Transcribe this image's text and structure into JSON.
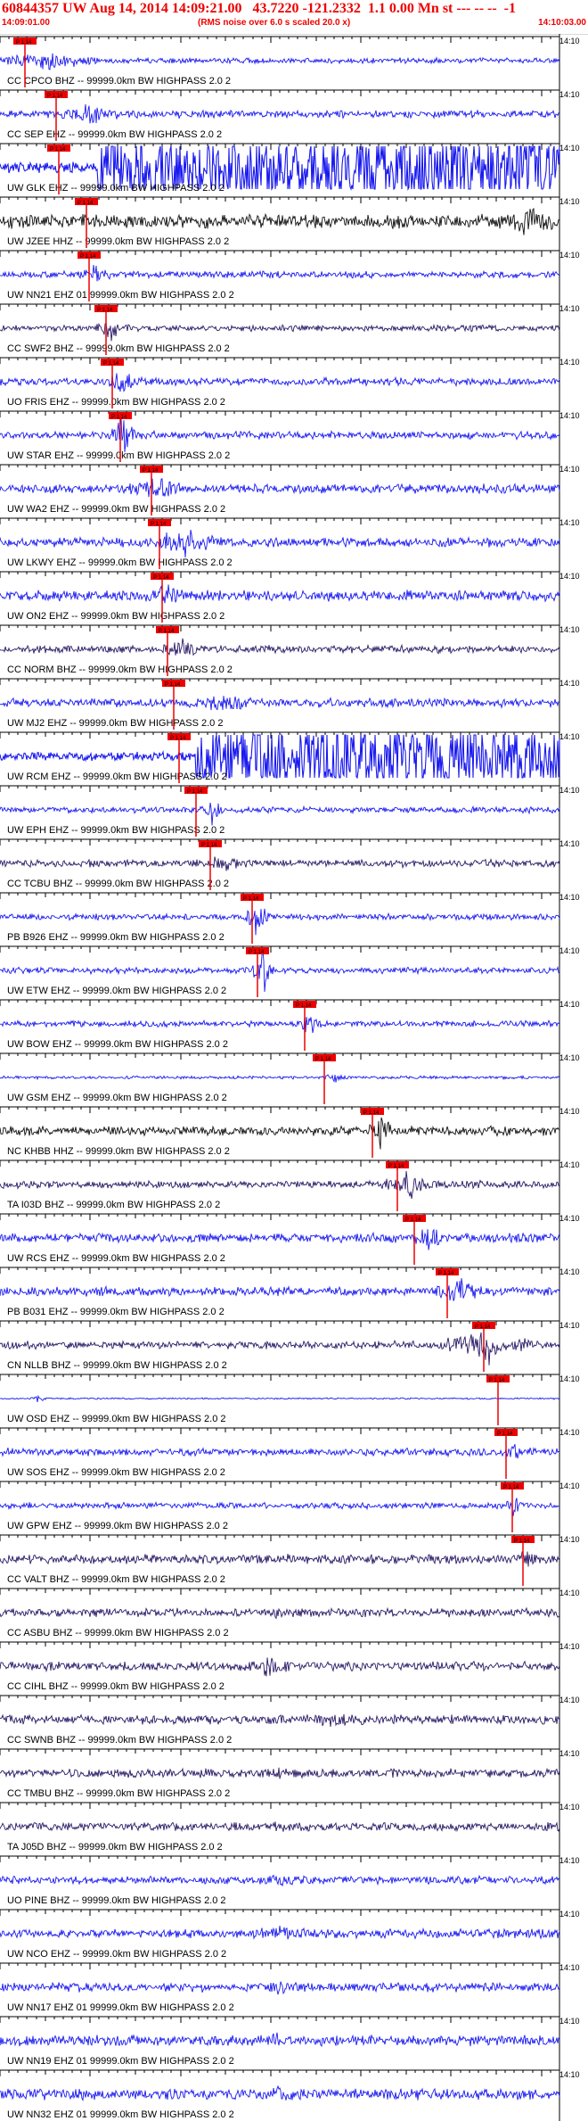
{
  "header": {
    "title": "60844357 UW Aug 14, 2014 14:09:21.00   43.7220 -121.2332  1.1 0.00 Mn st --- -- --  -1",
    "left_time": "14:09:01.00",
    "note": "(RMS noise over 6.0 s scaled 20.0 x)",
    "right_time": "14:10:03.00"
  },
  "colors": {
    "title": "#ee0000",
    "trace_blue": "#1a1af0",
    "trace_purple": "#2a1a66",
    "trace_black": "#111111",
    "pick_marker": "#ee0000",
    "pick_label_bg": "#ee0000",
    "pick_label_text": "#000000",
    "timeline": "#000000"
  },
  "time_axis_label": "14:10",
  "channels": [
    {
      "label": "CC CPCO BHZ -- 99999.0km BW  HIGHPASS  2.0  2",
      "color": "trace_blue",
      "amp": 0.18,
      "burst": 0.09,
      "burst_width": 0.18,
      "burst_amp": 0.6,
      "pick": 0.045,
      "pick_label": "P 1.14"
    },
    {
      "label": "CC SEP EHZ -- 99999.0km BW  HIGHPASS  2.0  2",
      "color": "trace_blue",
      "amp": 0.25,
      "burst": 0.16,
      "burst_width": 0.1,
      "burst_amp": 0.7,
      "pick": 0.1,
      "pick_label": "P 1.14"
    },
    {
      "label": "UW GLK EHZ -- 99999.0km BW  HIGHPASS  2.0  2",
      "color": "trace_blue",
      "amp": 0.35,
      "burst": 0.6,
      "burst_width": 0.85,
      "burst_amp": 2.4,
      "pick": 0.105,
      "pick_label": "P 1.14",
      "saturated": true
    },
    {
      "label": "UW JZEE HHZ -- 99999.0km BW  HIGHPASS  2.0  2",
      "color": "trace_black",
      "amp": 0.45,
      "burst": 0.95,
      "burst_width": 0.08,
      "burst_amp": 0.9,
      "pick": 0.155,
      "pick_label": "P 1.14"
    },
    {
      "label": "UW NN21 EHZ 01 99999.0km BW  HIGHPASS  2.0  2",
      "color": "trace_blue",
      "amp": 0.22,
      "burst": 0.17,
      "burst_width": 0.06,
      "burst_amp": 0.6,
      "pick": 0.16,
      "pick_label": "P 1.14"
    },
    {
      "label": "CC SWF2 BHZ -- 99999.0km BW  HIGHPASS  2.0  2",
      "color": "trace_purple",
      "amp": 0.2,
      "burst": 0.2,
      "burst_width": 0.06,
      "burst_amp": 0.8,
      "pick": 0.19,
      "pick_label": "P 1.14"
    },
    {
      "label": "UO FRIS EHZ -- 99999.0km BW  HIGHPASS  2.0  2",
      "color": "trace_blue",
      "amp": 0.25,
      "burst": 0.22,
      "burst_width": 0.07,
      "burst_amp": 0.9,
      "pick": 0.2,
      "pick_label": "P 1.14"
    },
    {
      "label": "UW STAR EHZ -- 99999.0km BW  HIGHPASS  2.0  2",
      "color": "trace_blue",
      "amp": 0.25,
      "burst": 0.22,
      "burst_width": 0.05,
      "burst_amp": 1.3,
      "pick": 0.215,
      "pick_label": "P 1.14"
    },
    {
      "label": "UW WA2 EHZ -- 99999.0km BW  HIGHPASS  2.0  2",
      "color": "trace_blue",
      "amp": 0.3,
      "burst": 0.28,
      "burst_width": 0.1,
      "burst_amp": 0.7,
      "pick": 0.27,
      "pick_label": "P 1.14"
    },
    {
      "label": "UW LKWY EHZ -- 99999.0km BW  HIGHPASS  2.0  2",
      "color": "trace_blue",
      "amp": 0.3,
      "burst": 0.33,
      "burst_width": 0.14,
      "burst_amp": 0.8,
      "pick": 0.285,
      "pick_label": "P 1.14"
    },
    {
      "label": "UW ON2 EHZ -- 99999.0km BW  HIGHPASS  2.0  2",
      "color": "trace_blue",
      "amp": 0.35,
      "burst": 0.3,
      "burst_width": 0.08,
      "burst_amp": 0.6,
      "pick": 0.29,
      "pick_label": "P 1.14"
    },
    {
      "label": "CC NORM BHZ -- 99999.0km BW  HIGHPASS  2.0  2",
      "color": "trace_purple",
      "amp": 0.25,
      "burst": 0.32,
      "burst_width": 0.08,
      "burst_amp": 0.6,
      "pick": 0.3,
      "pick_label": "P 1.14"
    },
    {
      "label": "UW MJ2 EHZ -- 99999.0km BW  HIGHPASS  2.0  2",
      "color": "trace_blue",
      "amp": 0.3,
      "burst": 0.4,
      "burst_width": 0.1,
      "burst_amp": 0.5,
      "pick": 0.31,
      "pick_label": "P 1.14"
    },
    {
      "label": "UW RCM EHZ -- 99999.0km BW  HIGHPASS  2.0  2",
      "color": "trace_blue",
      "amp": 0.3,
      "burst": 0.7,
      "burst_width": 0.7,
      "burst_amp": 2.4,
      "pick": 0.32,
      "pick_label": "P 1.14",
      "saturated": true
    },
    {
      "label": "UW EPH EHZ -- 99999.0km BW  HIGHPASS  2.0  2",
      "color": "trace_blue",
      "amp": 0.2,
      "burst": 0.38,
      "burst_width": 0.04,
      "burst_amp": 0.9,
      "pick": 0.35,
      "pick_label": "P 1.14"
    },
    {
      "label": "CC TCBU BHZ -- 99999.0km BW  HIGHPASS  2.0  2",
      "color": "trace_purple",
      "amp": 0.25,
      "burst": 0.4,
      "burst_width": 0.06,
      "burst_amp": 0.6,
      "pick": 0.375,
      "pick_label": "P 1.14"
    },
    {
      "label": "PB B926 EHZ -- 99999.0km BW  HIGHPASS  2.0  2",
      "color": "trace_blue",
      "amp": 0.2,
      "burst": 0.46,
      "burst_width": 0.05,
      "burst_amp": 1.4,
      "pick": 0.45,
      "pick_label": "P 1.14"
    },
    {
      "label": "UW ETW EHZ -- 99999.0km BW  HIGHPASS  2.0  2",
      "color": "trace_blue",
      "amp": 0.2,
      "burst": 0.47,
      "burst_width": 0.04,
      "burst_amp": 1.6,
      "pick": 0.46,
      "pick_label": "P 1.14"
    },
    {
      "label": "UW BOW EHZ -- 99999.0km BW  HIGHPASS  2.0  2",
      "color": "trace_blue",
      "amp": 0.2,
      "burst": 0.55,
      "burst_width": 0.05,
      "burst_amp": 0.9,
      "pick": 0.545,
      "pick_label": "P 1.14"
    },
    {
      "label": "UW GSM EHZ -- 99999.0km BW  HIGHPASS  2.0  2",
      "color": "trace_blue",
      "amp": 0.1,
      "burst": 0.6,
      "burst_width": 0.05,
      "burst_amp": 0.3,
      "pick": 0.58,
      "pick_label": "P 1.14"
    },
    {
      "label": "NC KHBB HHZ -- 99999.0km BW  HIGHPASS  2.0  2",
      "color": "trace_black",
      "amp": 0.3,
      "burst": 0.68,
      "burst_width": 0.05,
      "burst_amp": 0.9,
      "pick": 0.665,
      "pick_label": "P 1.14"
    },
    {
      "label": "TA I03D BHZ -- 99999.0km BW  HIGHPASS  2.0  2",
      "color": "trace_purple",
      "amp": 0.25,
      "burst": 0.73,
      "burst_width": 0.1,
      "burst_amp": 0.8,
      "pick": 0.71,
      "pick_label": "P 1.14"
    },
    {
      "label": "UW RCS EHZ -- 99999.0km BW  HIGHPASS  2.0  2",
      "color": "trace_blue",
      "amp": 0.3,
      "burst": 0.77,
      "burst_width": 0.06,
      "burst_amp": 1.0,
      "pick": 0.74,
      "pick_label": "P 1.14"
    },
    {
      "label": "PB B031 EHZ -- 99999.0km BW  HIGHPASS  2.0  2",
      "color": "trace_blue",
      "amp": 0.3,
      "burst": 0.82,
      "burst_width": 0.08,
      "burst_amp": 1.1,
      "pick": 0.8,
      "pick_label": "P 1.14"
    },
    {
      "label": "CN NLLB BHZ -- 99999.0km BW  HIGHPASS  2.0  2",
      "color": "trace_purple",
      "amp": 0.25,
      "burst": 0.87,
      "burst_width": 0.18,
      "burst_amp": 1.0,
      "pick": 0.865,
      "pick_label": "P 1.14"
    },
    {
      "label": "UW OSD EHZ -- 99999.0km BW  HIGHPASS  2.0  2",
      "color": "trace_blue",
      "amp": 0.05,
      "burst": 0.07,
      "burst_width": 0.03,
      "burst_amp": 0.3,
      "pick": 0.89,
      "pick_label": "P 1.14"
    },
    {
      "label": "UW SOS EHZ -- 99999.0km BW  HIGHPASS  2.0  2",
      "color": "trace_blue",
      "amp": 0.25,
      "burst": 0.92,
      "burst_width": 0.04,
      "burst_amp": 0.5,
      "pick": 0.905,
      "pick_label": "P 1.14"
    },
    {
      "label": "UW GPW EHZ -- 99999.0km BW  HIGHPASS  2.0  2",
      "color": "trace_blue",
      "amp": 0.2,
      "burst": 0.92,
      "burst_width": 0.03,
      "burst_amp": 1.2,
      "pick": 0.915,
      "pick_label": "P 1.14"
    },
    {
      "label": "CC VALT BHZ -- 99999.0km BW  HIGHPASS  2.0  2",
      "color": "trace_purple",
      "amp": 0.3,
      "burst": 0.94,
      "burst_width": 0.03,
      "burst_amp": 0.8,
      "pick": 0.935,
      "pick_label": "P 1.14"
    },
    {
      "label": "CC ASBU BHZ -- 99999.0km BW  HIGHPASS  2.0  2",
      "color": "trace_purple",
      "amp": 0.28,
      "burst": 0.5,
      "burst_width": 0.05,
      "burst_amp": 0.3
    },
    {
      "label": "CC CIHL BHZ -- 99999.0km BW  HIGHPASS  2.0  2",
      "color": "trace_purple",
      "amp": 0.3,
      "burst": 0.48,
      "burst_width": 0.08,
      "burst_amp": 0.5
    },
    {
      "label": "CC SWNB BHZ -- 99999.0km BW  HIGHPASS  2.0  2",
      "color": "trace_purple",
      "amp": 0.3,
      "burst": 0.6,
      "burst_width": 0.1,
      "burst_amp": 0.3
    },
    {
      "label": "CC TMBU BHZ -- 99999.0km BW  HIGHPASS  2.0  2",
      "color": "trace_purple",
      "amp": 0.28,
      "burst": 0.5,
      "burst_width": 0.1,
      "burst_amp": 0.2
    },
    {
      "label": "TA J05D BHZ -- 99999.0km BW  HIGHPASS  2.0  2",
      "color": "trace_purple",
      "amp": 0.28,
      "burst": 0.5,
      "burst_width": 0.1,
      "burst_amp": 0.2
    },
    {
      "label": "UO PINE BHZ -- 99999.0km BW  HIGHPASS  2.0  2",
      "color": "trace_blue",
      "amp": 0.25,
      "burst": 0.5,
      "burst_width": 0.1,
      "burst_amp": 0.2
    },
    {
      "label": "UW NCO EHZ -- 99999.0km BW  HIGHPASS  2.0  2",
      "color": "trace_blue",
      "amp": 0.3,
      "burst": 0.5,
      "burst_width": 0.1,
      "burst_amp": 0.2
    },
    {
      "label": "UW NN17 EHZ 01 99999.0km BW  HIGHPASS  2.0  2",
      "color": "trace_blue",
      "amp": 0.3,
      "burst": 0.5,
      "burst_width": 0.1,
      "burst_amp": 0.2
    },
    {
      "label": "UW NN19 EHZ 01 99999.0km BW  HIGHPASS  2.0  2",
      "color": "trace_blue",
      "amp": 0.35,
      "burst": 0.5,
      "burst_width": 0.1,
      "burst_amp": 0.2
    },
    {
      "label": "UW NN32 EHZ 01 99999.0km BW  HIGHPASS  2.0  2",
      "color": "trace_blue",
      "amp": 0.35,
      "burst": 0.5,
      "burst_width": 0.1,
      "burst_amp": 0.2
    }
  ]
}
